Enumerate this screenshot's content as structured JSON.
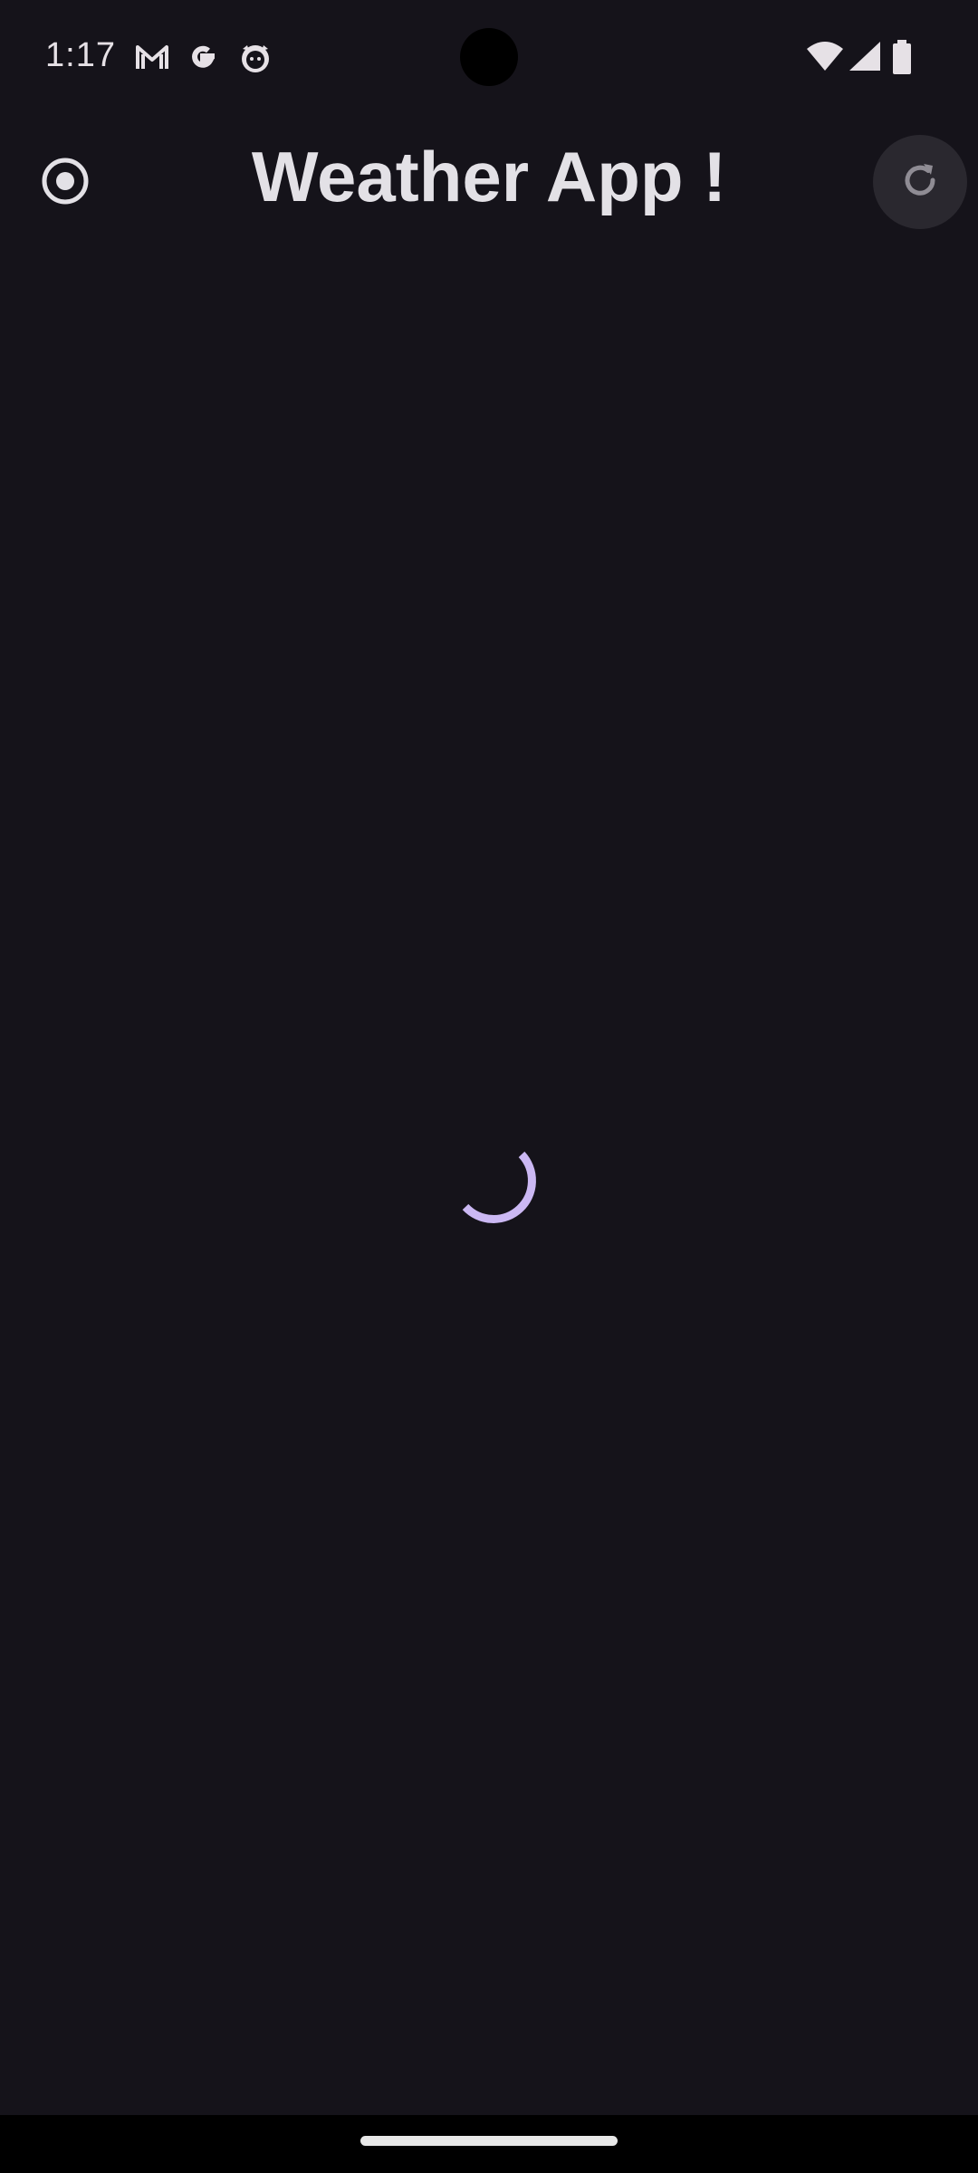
{
  "status_bar": {
    "time": "1:17",
    "left_icons": [
      "gmail-icon",
      "google-icon",
      "cat-app-icon"
    ],
    "right_icons": [
      "wifi-icon",
      "signal-icon",
      "battery-icon"
    ]
  },
  "app_bar": {
    "title": "Weather App !",
    "nav_icon": "radio-target-icon",
    "action_icon": "refresh-icon"
  },
  "content": {
    "state": "loading",
    "spinner_color": "#cbb8f3"
  },
  "colors": {
    "background": "#15131a",
    "title": "#e3e1e6",
    "refresh_button_bg": "#2a282f"
  }
}
